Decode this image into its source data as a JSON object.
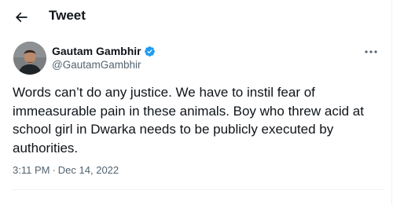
{
  "header": {
    "title": "Tweet",
    "back_icon": "arrow-left-icon"
  },
  "tweet": {
    "author": {
      "name": "Gautam Gambhir",
      "handle": "@GautamGambhir",
      "verified": true,
      "verified_color": "#1d9bf0"
    },
    "more_icon": "more-horizontal-icon",
    "text": "Words can’t do any justice. We have to instil fear of immeasurable pain in these animals. Boy who threw acid at school girl in Dwarka needs to be publicly executed by authorities.",
    "time": "3:11 PM",
    "separator": "·",
    "date": "Dec 14, 2022"
  },
  "colors": {
    "text_primary": "#0f1419",
    "text_secondary": "#536471",
    "border": "#eff3f4"
  }
}
